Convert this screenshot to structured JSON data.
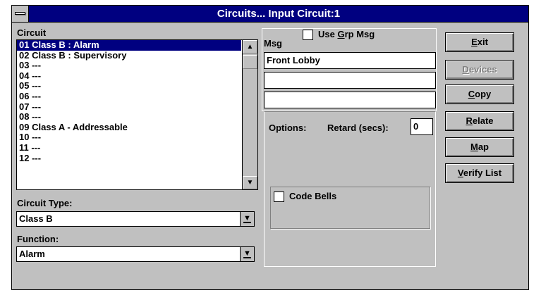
{
  "window": {
    "title": "Circuits... Input Circuit:1"
  },
  "circuit": {
    "label": "Circuit",
    "items": [
      "01 Class B : Alarm",
      "02 Class B : Supervisory",
      "03 ---",
      "04 ---",
      "05 ---",
      "06 ---",
      "07 ---",
      "08 ---",
      "09 Class A - Addressable",
      "10 ---",
      "11 ---",
      "12 ---"
    ],
    "selected_index": 0
  },
  "circuit_type": {
    "label": "Circuit Type:",
    "value": "Class B"
  },
  "function": {
    "label": "Function:",
    "value": "Alarm"
  },
  "msg": {
    "label": "Msg",
    "use_grp_msg": {
      "label_pre": "Use ",
      "label_key": "G",
      "label_post": "rp Msg",
      "checked": false
    },
    "lines": [
      "Front Lobby",
      "",
      ""
    ]
  },
  "options": {
    "label": "Options:",
    "retard_label": "Retard (secs):",
    "retard_value": "0",
    "code_bells": {
      "label": "Code Bells",
      "checked": false
    }
  },
  "buttons": [
    {
      "key": "E",
      "rest": "xit",
      "enabled": true
    },
    {
      "key": "D",
      "rest": "evices",
      "enabled": false
    },
    {
      "key": "C",
      "rest": "opy",
      "enabled": true
    },
    {
      "key": "R",
      "rest": "elate",
      "enabled": true
    },
    {
      "key": "M",
      "rest": "ap",
      "enabled": true
    },
    {
      "key": "V",
      "rest": "erify List",
      "enabled": true
    }
  ]
}
